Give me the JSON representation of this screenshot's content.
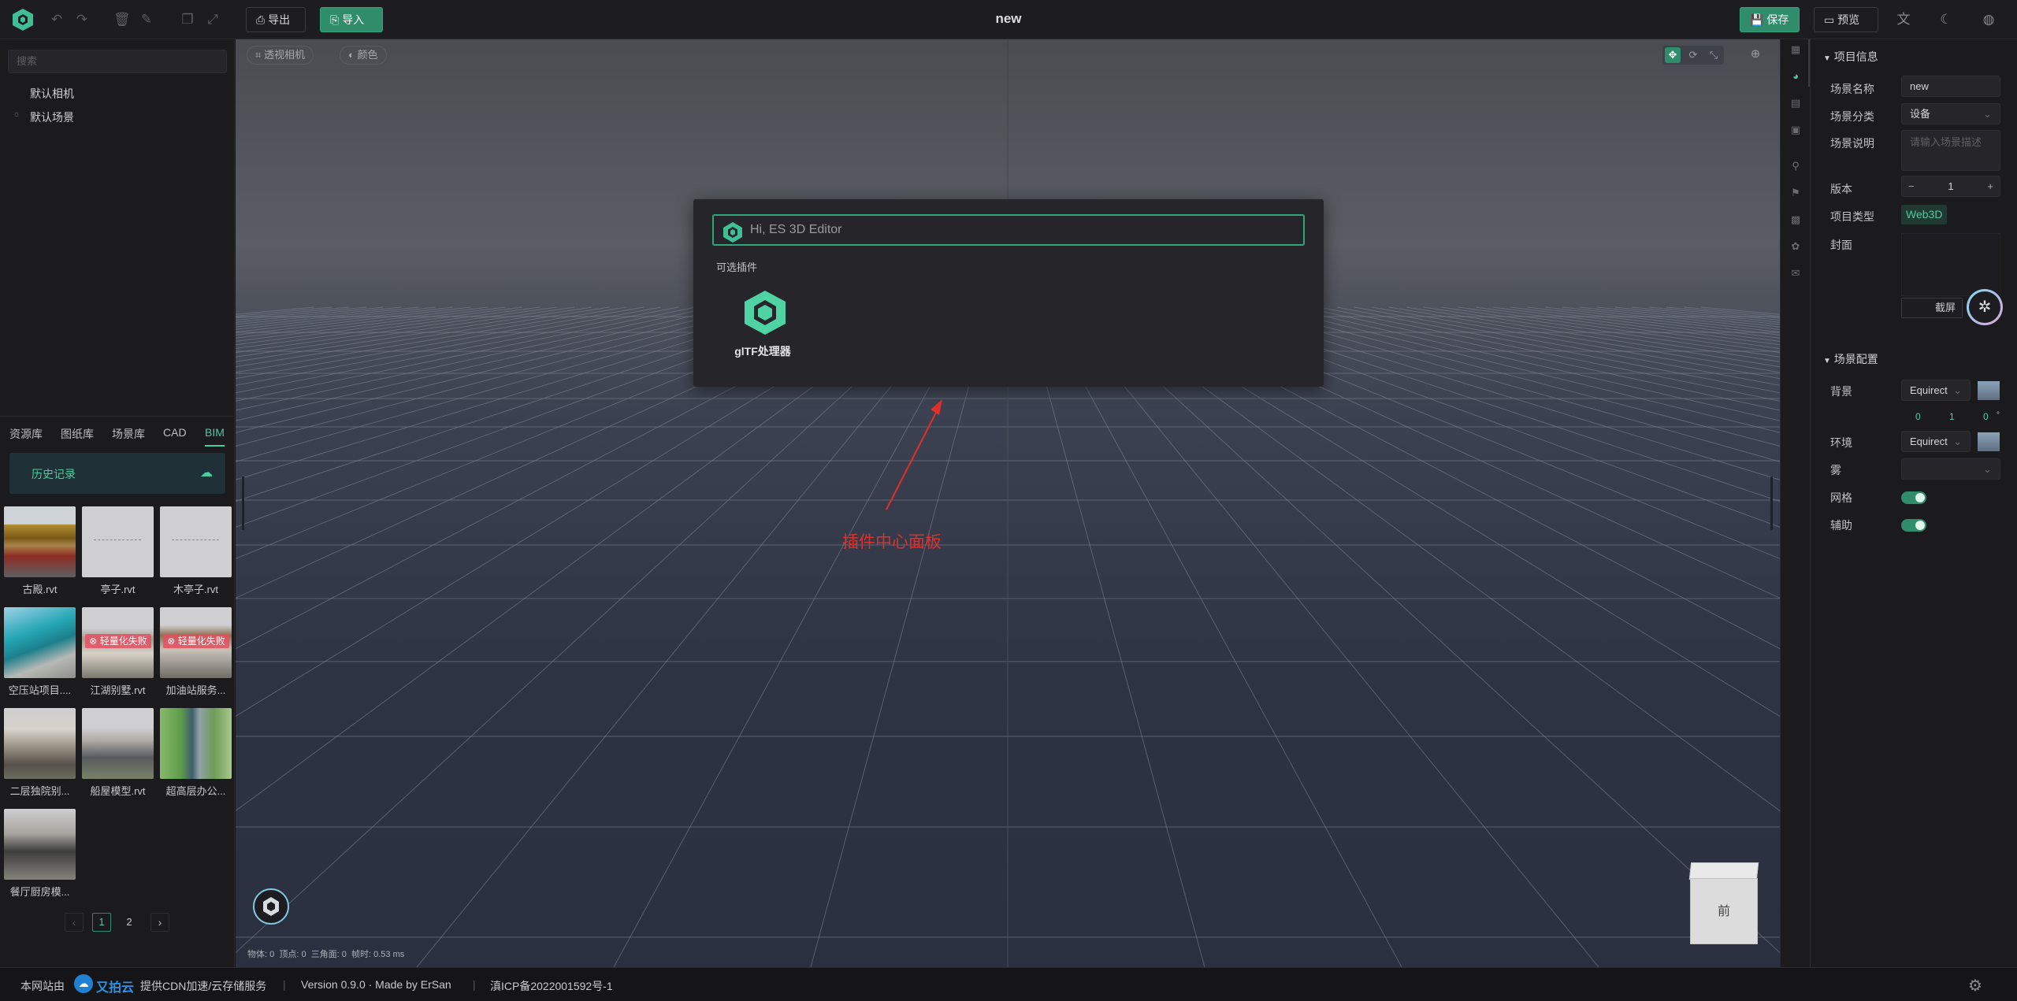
{
  "topbar": {
    "title": "new",
    "export_label": "导出",
    "import_label": "导入",
    "save_label": "保存",
    "preview_label": "预览"
  },
  "left_panel": {
    "search_placeholder": "搜索",
    "tree": [
      "默认相机",
      "默认场景"
    ],
    "tabs": [
      "资源库",
      "图纸库",
      "场景库",
      "CAD",
      "BIM"
    ],
    "active_tab": "BIM",
    "history_label": "历史记录",
    "assets": [
      {
        "name": "古殿.rvt",
        "failed": false
      },
      {
        "name": "亭子.rvt",
        "failed": false
      },
      {
        "name": "木亭子.rvt",
        "failed": false
      },
      {
        "name": "空压站项目....",
        "failed": false
      },
      {
        "name": "江湖别墅.rvt",
        "failed": true
      },
      {
        "name": "加油站服务...",
        "failed": true
      },
      {
        "name": "二层独院别...",
        "failed": false
      },
      {
        "name": "船屋模型.rvt",
        "failed": false
      },
      {
        "name": "超高层办公...",
        "failed": false
      },
      {
        "name": "餐厅厨房模...",
        "failed": false
      }
    ],
    "failed_label": "轻量化失败",
    "pagination": {
      "pages": [
        "1",
        "2"
      ],
      "current": "1"
    }
  },
  "viewport": {
    "camera_label": "透视相机",
    "color_label": "颜色",
    "stats": "物体: 0  顶点: 0  三角面: 0  帧时: 0.53 ms",
    "cube_face": "前",
    "annotation": "插件中心面板"
  },
  "plugin_modal": {
    "input_placeholder": "Hi, ES 3D Editor",
    "section_label": "可选插件",
    "plugins": [
      {
        "name": "glTF处理器",
        "icon": "gltf-plugin-icon"
      }
    ]
  },
  "right_panel": {
    "project_info_title": "项目信息",
    "scene_name_label": "场景名称",
    "scene_name_value": "new",
    "scene_category_label": "场景分类",
    "scene_category_value": "设备",
    "scene_desc_label": "场景说明",
    "scene_desc_placeholder": "请输入场景描述",
    "version_label": "版本",
    "version_value": "1",
    "project_type_label": "项目类型",
    "project_type_value": "Web3D",
    "cover_label": "封面",
    "screenshot_label": "截屏",
    "scene_config_title": "场景配置",
    "background_label": "背景",
    "background_value": "Equirect",
    "rotation": [
      "0",
      "1",
      "0"
    ],
    "environment_label": "环境",
    "environment_value": "Equirect",
    "fog_label": "雾",
    "grid_label": "网格",
    "grid_on": true,
    "helper_label": "辅助",
    "helper_on": true
  },
  "footer": {
    "site_label": "本网站由",
    "cdn_brand": "又拍云",
    "cdn_text": "提供CDN加速/云存储服务",
    "version_text": "Version 0.9.0 · Made by ErSan",
    "icp_text": "滇ICP备2022001592号-1"
  },
  "colors": {
    "accent": "#2f8d6b",
    "accent_light": "#4ccaa0",
    "annotation": "#e0302a"
  }
}
